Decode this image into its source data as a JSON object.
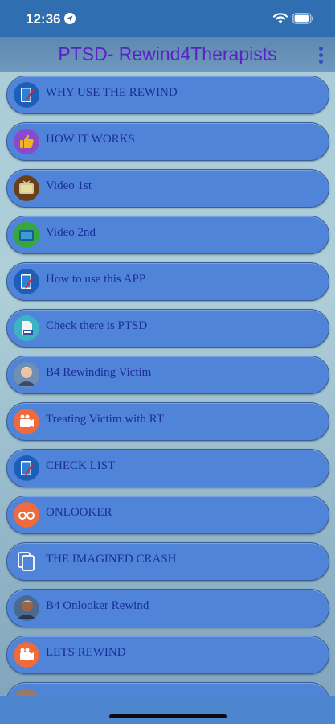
{
  "status": {
    "time": "12:36"
  },
  "app": {
    "title": "PTSD- Rewind4Therapists"
  },
  "items": [
    {
      "label": "WHY USE THE REWIND",
      "icon": "notepad-pencil-icon"
    },
    {
      "label": "HOW IT WORKS",
      "icon": "thumbs-up-icon"
    },
    {
      "label": "Video 1st",
      "icon": "tv-icon"
    },
    {
      "label": "Video 2nd",
      "icon": "tv-icon"
    },
    {
      "label": "How to use this APP",
      "icon": "notepad-pencil-icon"
    },
    {
      "label": "Check there is PTSD",
      "icon": "psd-file-icon"
    },
    {
      "label": "B4 Rewinding Victim",
      "icon": "person-photo-icon"
    },
    {
      "label": "Treating Victim with RT",
      "icon": "camera-icon"
    },
    {
      "label": "CHECK LIST",
      "icon": "notepad-pencil-icon"
    },
    {
      "label": "ONLOOKER",
      "icon": "glasses-icon"
    },
    {
      "label": "THE IMAGINED CRASH",
      "icon": "pages-icon"
    },
    {
      "label": "B4 Onlooker Rewind",
      "icon": "person-photo-icon"
    },
    {
      "label": "LETS REWIND",
      "icon": "camera-icon"
    }
  ]
}
